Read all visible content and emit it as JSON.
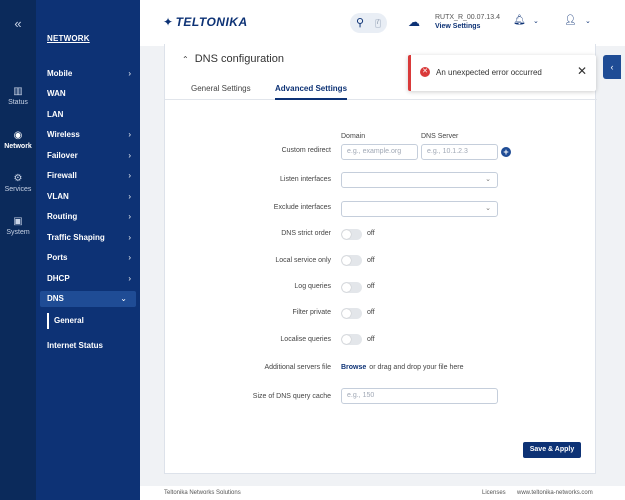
{
  "rail": {
    "collapse_glyph": "«",
    "items": [
      {
        "label": "Status",
        "icon": "status-bars-icon"
      },
      {
        "label": "Network",
        "icon": "network-globe-icon"
      },
      {
        "label": "Services",
        "icon": "services-gear-icon"
      },
      {
        "label": "System",
        "icon": "system-icon"
      }
    ]
  },
  "menu": {
    "title": "NETWORK",
    "items": [
      {
        "label": "Mobile",
        "has_children": true
      },
      {
        "label": "WAN",
        "has_children": false
      },
      {
        "label": "LAN",
        "has_children": false
      },
      {
        "label": "Wireless",
        "has_children": true
      },
      {
        "label": "Failover",
        "has_children": true
      },
      {
        "label": "Firewall",
        "has_children": true
      },
      {
        "label": "VLAN",
        "has_children": true
      },
      {
        "label": "Routing",
        "has_children": true
      },
      {
        "label": "Traffic Shaping",
        "has_children": true
      },
      {
        "label": "Ports",
        "has_children": true
      },
      {
        "label": "DHCP",
        "has_children": true
      },
      {
        "label": "DNS",
        "has_children": true,
        "expanded": true
      },
      {
        "label": "Internet Status",
        "has_children": false
      }
    ],
    "dns_sub": "General"
  },
  "header": {
    "logo": "TELTONIKA",
    "search_shortcut": "/",
    "firmware": "RUTX_R_00.07.13.4",
    "view_settings": "View Settings"
  },
  "toast": {
    "message": "An unexpected error occurred",
    "close": "✕",
    "color": "#d93a3a"
  },
  "card": {
    "title": "DNS configuration",
    "tabs": [
      "General Settings",
      "Advanced Settings"
    ],
    "active_tab": 1,
    "col_domain": "Domain",
    "col_dns_server": "DNS Server",
    "fields": {
      "custom_redirect": {
        "label": "Custom redirect",
        "domain_placeholder": "e.g., example.org",
        "server_placeholder": "e.g., 10.1.2.3"
      },
      "listen_interfaces": {
        "label": "Listen interfaces"
      },
      "exclude_interfaces": {
        "label": "Exclude interfaces"
      },
      "dns_strict_order": {
        "label": "DNS strict order",
        "state": "off"
      },
      "local_service_only": {
        "label": "Local service only",
        "state": "off"
      },
      "log_queries": {
        "label": "Log queries",
        "state": "off"
      },
      "filter_private": {
        "label": "Filter private",
        "state": "off"
      },
      "localise_queries": {
        "label": "Localise queries",
        "state": "off"
      },
      "additional_servers_file": {
        "label": "Additional servers file",
        "browse": "Browse",
        "drag_text": "or drag and drop your file here"
      },
      "dns_query_cache": {
        "label": "Size of DNS query cache",
        "placeholder": "e.g., 150"
      }
    },
    "save_apply": "Save & Apply"
  },
  "footer": {
    "company": "Teltonika Networks Solutions",
    "licenses": "Licenses",
    "website": "www.teltonika-networks.com"
  },
  "colors": {
    "rail": "#0b2a5b",
    "menu": "#0d3275",
    "accent": "#0d3275",
    "error": "#d93a3a"
  }
}
